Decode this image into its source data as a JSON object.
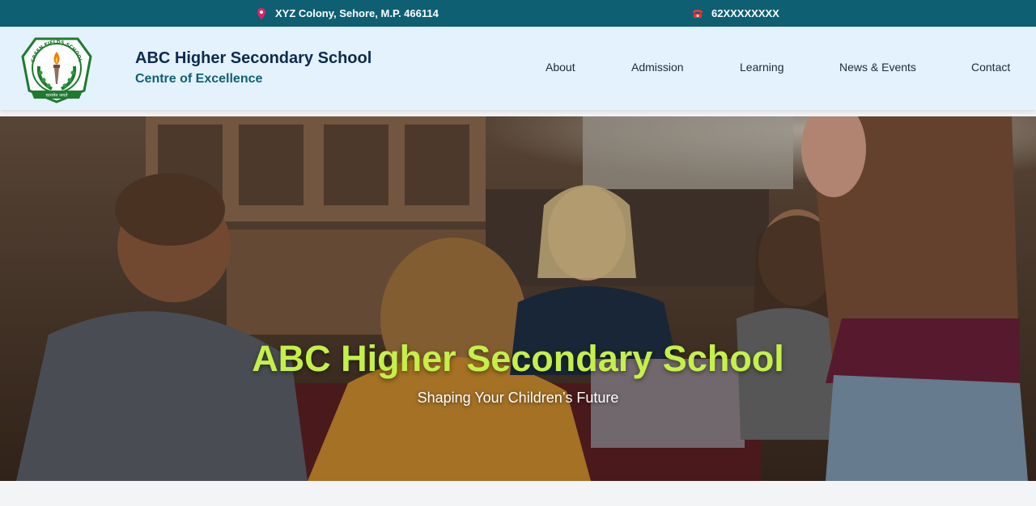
{
  "topbar": {
    "address": "XYZ Colony, Sehore, M.P. 466114",
    "address_icon": "map-pin-icon",
    "phone": "62XXXXXXXX",
    "phone_icon": "telephone-icon",
    "background": "#0f5f73"
  },
  "header": {
    "logo": {
      "ring_text": "GREEN FIELDS SCHOOL",
      "banner_text": "सत्यमेव जयते"
    },
    "school_name": "ABC Higher Secondary School",
    "tagline": "Centre of Excellence",
    "background": "#e3f2fd"
  },
  "nav": {
    "items": [
      {
        "label": "About"
      },
      {
        "label": "Admission"
      },
      {
        "label": "Learning"
      },
      {
        "label": "News & Events"
      },
      {
        "label": "Contact"
      }
    ]
  },
  "hero": {
    "title": "ABC Higher Secondary School",
    "subtitle": "Shaping Your Children’s Future",
    "title_color": "#c5f04a"
  }
}
